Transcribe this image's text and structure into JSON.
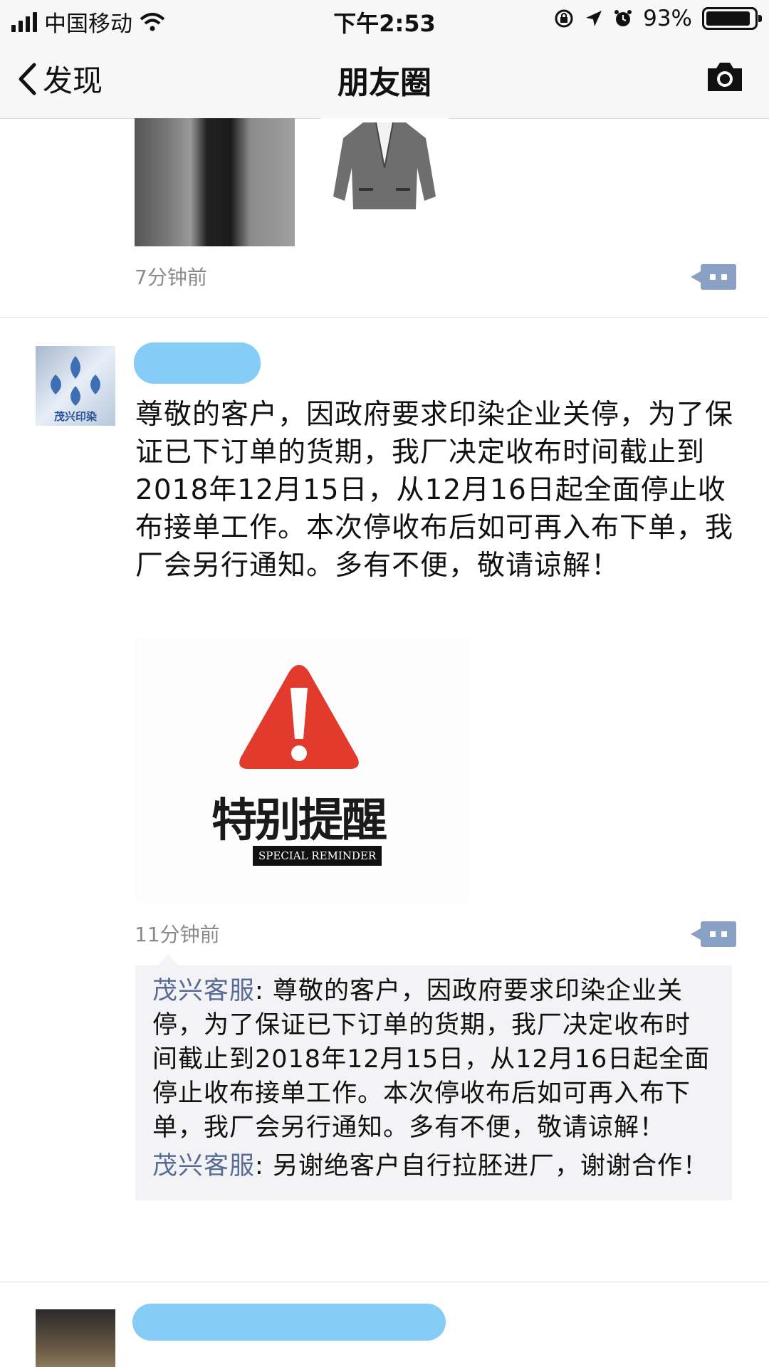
{
  "status_bar": {
    "carrier": "中国移动",
    "time": "下午2:53",
    "battery_percent_label": "93%",
    "battery_level": 0.93
  },
  "nav": {
    "back_label": "发现",
    "title": "朋友圈",
    "camera_icon": "camera-icon"
  },
  "posts": [
    {
      "time": "7分钟前"
    },
    {
      "content": "尊敬的客户，因政府要求印染企业关停，为了保证已下订单的货期，我厂决定收布时间截止到2018年12月15日，从12月16日起全面停止收布接单工作。本次停收布后如可再入布下单，我厂会另行通知。多有不便，敬请谅解！",
      "avatar_text": "茂兴印染",
      "image": {
        "title": "特别提醒",
        "subtitle": "SPECIAL REMINDER"
      },
      "time": "11分钟前",
      "comments": [
        {
          "author": "茂兴客服",
          "separator": ": ",
          "text": "尊敬的客户，因政府要求印染企业关停，为了保证已下订单的货期，我厂决定收布时间截止到2018年12月15日，从12月16日起全面停止收布接单工作。本次停收布后如可再入布下单，我厂会另行通知。多有不便，敬请谅解！"
        },
        {
          "author": "茂兴客服",
          "separator": ": ",
          "text": "另谢绝客户自行拉胚进厂，谢谢合作！"
        }
      ]
    }
  ],
  "colors": {
    "accent_link": "#576b95",
    "more_button": "#8aa0c4",
    "warning_red": "#e23b2e",
    "name_blur": "#85cdf6"
  }
}
